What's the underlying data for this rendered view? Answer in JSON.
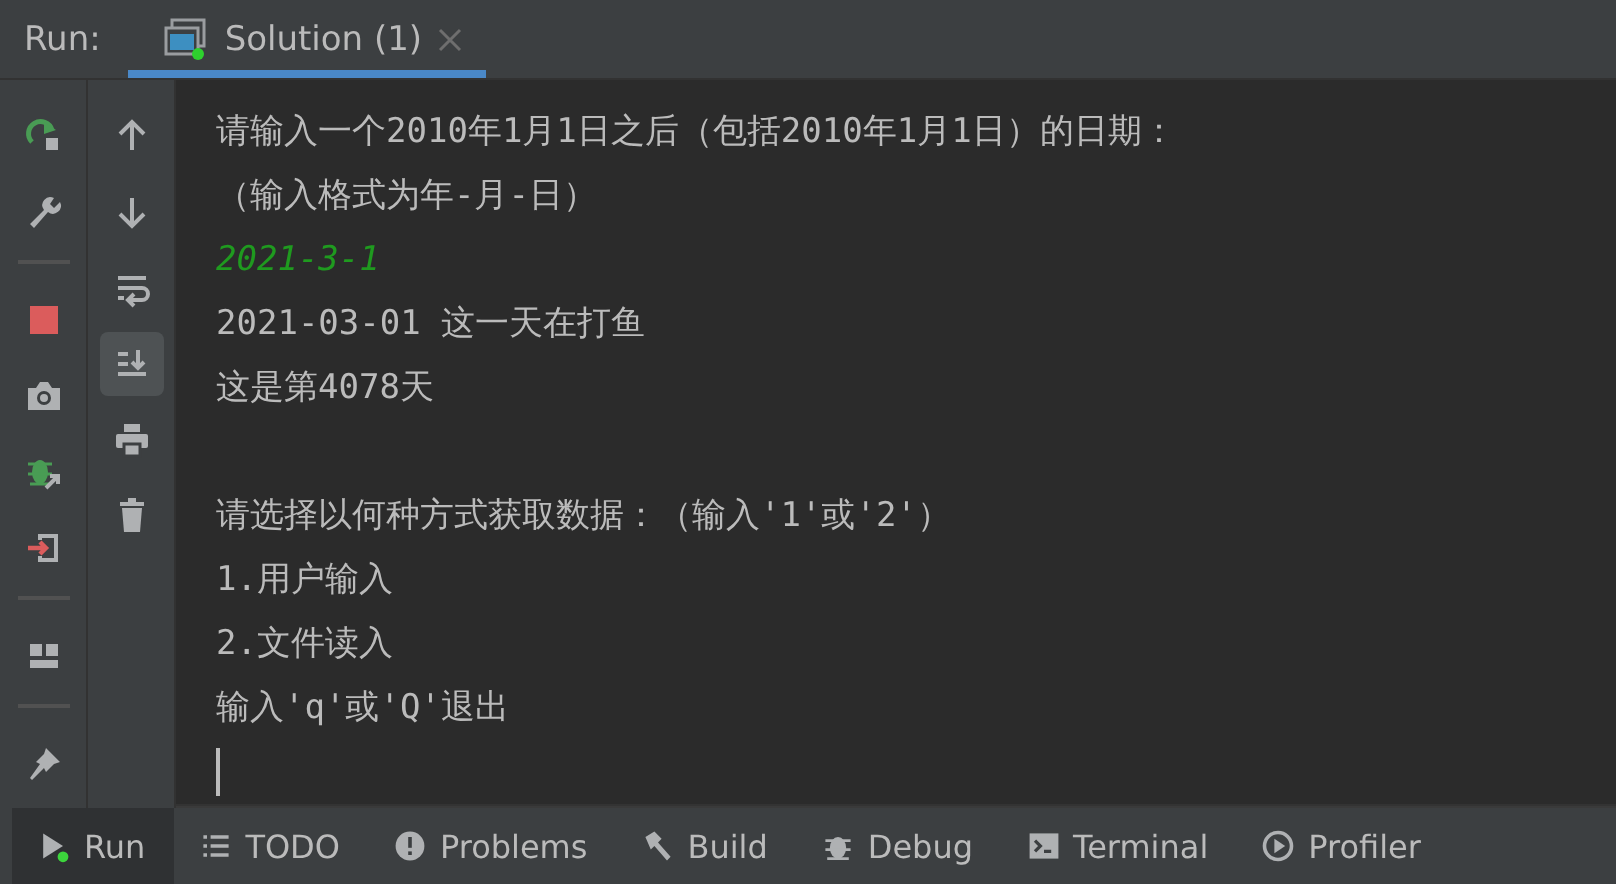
{
  "header": {
    "label": "Run:",
    "tabs": [
      {
        "label": "Solution (1)",
        "selected": true
      }
    ]
  },
  "toolbar_left": [
    {
      "kind": "rerun"
    },
    {
      "kind": "wrench"
    },
    {
      "kind": "separator"
    },
    {
      "kind": "stop"
    },
    {
      "kind": "camera"
    },
    {
      "kind": "debug"
    },
    {
      "kind": "exit"
    },
    {
      "kind": "separator"
    },
    {
      "kind": "layout"
    },
    {
      "kind": "separator"
    },
    {
      "kind": "pin"
    }
  ],
  "toolbar_right": [
    {
      "kind": "up",
      "selected": false
    },
    {
      "kind": "down",
      "selected": false
    },
    {
      "kind": "wrap",
      "selected": false
    },
    {
      "kind": "scroll-end",
      "selected": true
    },
    {
      "kind": "print",
      "selected": false
    },
    {
      "kind": "trash",
      "selected": false
    }
  ],
  "console": [
    {
      "kind": "output",
      "text": "请输入一个2010年1月1日之后（包括2010年1月1日）的日期："
    },
    {
      "kind": "output",
      "text": "（输入格式为年-月-日）"
    },
    {
      "kind": "input",
      "text": "2021-3-1"
    },
    {
      "kind": "output",
      "text": "2021-03-01 这一天在打鱼"
    },
    {
      "kind": "output",
      "text": "这是第4078天"
    },
    {
      "kind": "blank"
    },
    {
      "kind": "output",
      "text": "请选择以何种方式获取数据：（输入'1'或'2'）"
    },
    {
      "kind": "output",
      "text": "1.用户输入"
    },
    {
      "kind": "output",
      "text": "2.文件读入"
    },
    {
      "kind": "output",
      "text": "输入'q'或'Q'退出"
    },
    {
      "kind": "cursor"
    }
  ],
  "bottom_tabs": [
    {
      "kind": "run",
      "label": "Run",
      "selected": true
    },
    {
      "kind": "todo",
      "label": "TODO",
      "selected": false
    },
    {
      "kind": "problems",
      "label": "Problems",
      "selected": false
    },
    {
      "kind": "build",
      "label": "Build",
      "selected": false
    },
    {
      "kind": "debug",
      "label": "Debug",
      "selected": false
    },
    {
      "kind": "terminal",
      "label": "Terminal",
      "selected": false
    },
    {
      "kind": "profiler",
      "label": "Profiler",
      "selected": false
    }
  ]
}
